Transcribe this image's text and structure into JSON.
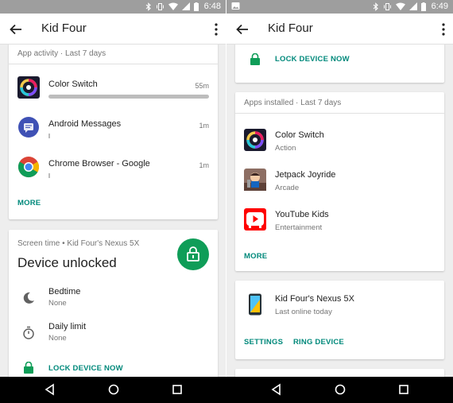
{
  "colors": {
    "accent": "#00897b",
    "lock_green": "#0f9d58",
    "statusbar": "#9e9e9e",
    "background": "#eeeeee"
  },
  "left": {
    "status_time": "6:48",
    "title": "Kid Four",
    "activity": {
      "header": "App activity · Last 7 days",
      "apps": [
        {
          "name": "Color Switch",
          "time": "55m",
          "icon": "color-switch-icon",
          "usage_fraction": 1.0
        },
        {
          "name": "Android Messages",
          "time": "1m",
          "icon": "messages-icon",
          "usage_fraction": 0.02
        },
        {
          "name": "Chrome Browser - Google",
          "time": "1m",
          "icon": "chrome-icon",
          "usage_fraction": 0.02
        }
      ],
      "more": "MORE"
    },
    "screen_time": {
      "header": "Screen time • Kid Four's Nexus 5X",
      "status": "Device unlocked",
      "items": [
        {
          "label": "Bedtime",
          "value": "None",
          "icon": "moon-icon"
        },
        {
          "label": "Daily limit",
          "value": "None",
          "icon": "timer-icon"
        }
      ],
      "lock": "LOCK DEVICE NOW"
    }
  },
  "right": {
    "status_time": "6:49",
    "title": "Kid Four",
    "lock": "LOCK DEVICE NOW",
    "installed": {
      "header": "Apps installed · Last 7 days",
      "apps": [
        {
          "name": "Color Switch",
          "category": "Action",
          "icon": "color-switch-icon"
        },
        {
          "name": "Jetpack Joyride",
          "category": "Arcade",
          "icon": "jetpack-joyride-icon"
        },
        {
          "name": "YouTube Kids",
          "category": "Entertainment",
          "icon": "youtube-kids-icon"
        }
      ],
      "more": "MORE"
    },
    "device": {
      "name": "Kid Four's Nexus 5X",
      "status": "Last online today",
      "settings": "SETTINGS",
      "ring": "RING DEVICE"
    }
  }
}
